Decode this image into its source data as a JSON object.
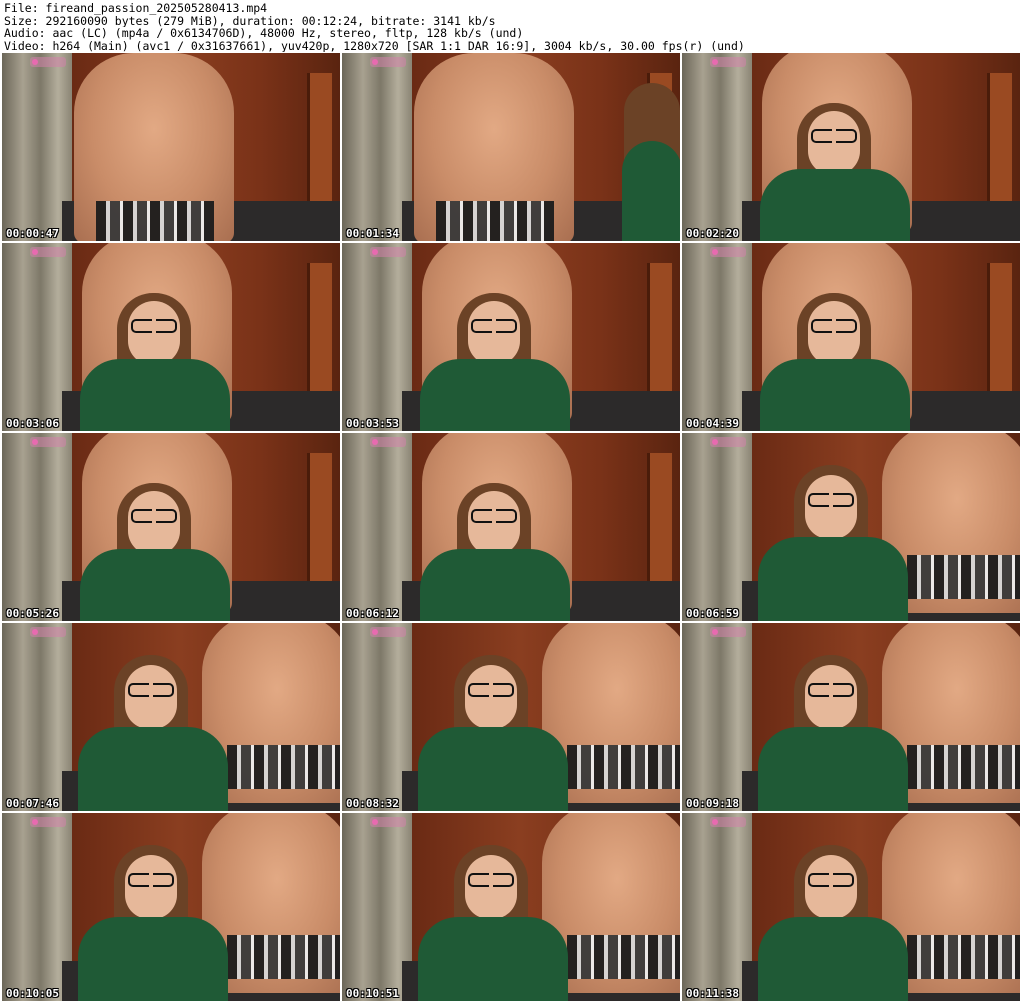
{
  "header": {
    "file_line": "File: fireand_passion_202505280413.mp4",
    "size_line": "Size: 292160090 bytes (279 MiB), duration: 00:12:24, bitrate: 3141 kb/s",
    "audio_line": "Audio: aac (LC) (mp4a / 0x6134706D), 48000 Hz, stereo, fltp, 128 kb/s (und)",
    "video_line": "Video: h264 (Main) (avc1 / 0x31637661), yuv420p, 1280x720 [SAR 1:1 DAR 16:9], 3004 kb/s, 30.00 fps(r) (und)"
  },
  "thumbnails": [
    {
      "time": "00:00:47",
      "scene": "man-center"
    },
    {
      "time": "00:01:34",
      "scene": "man-center-hair-right"
    },
    {
      "time": "00:02:20",
      "scene": "woman-front-man-behind"
    },
    {
      "time": "00:03:06",
      "scene": "woman-front-man-behind"
    },
    {
      "time": "00:03:53",
      "scene": "woman-front-man-behind"
    },
    {
      "time": "00:04:39",
      "scene": "woman-front-man-behind"
    },
    {
      "time": "00:05:26",
      "scene": "woman-front-man-behind"
    },
    {
      "time": "00:06:12",
      "scene": "woman-front-man-behind"
    },
    {
      "time": "00:06:59",
      "scene": "woman-left-man-right"
    },
    {
      "time": "00:07:46",
      "scene": "woman-left-man-right"
    },
    {
      "time": "00:08:32",
      "scene": "woman-left-man-right"
    },
    {
      "time": "00:09:18",
      "scene": "woman-left-man-right"
    },
    {
      "time": "00:10:05",
      "scene": "woman-left-man-right"
    },
    {
      "time": "00:10:51",
      "scene": "woman-left-man-right"
    },
    {
      "time": "00:11:38",
      "scene": "woman-left-man-right"
    }
  ],
  "colors": {
    "wall": "#7a3218",
    "shirt": "#1f5a36",
    "timestamp_text": "#ffffff"
  }
}
